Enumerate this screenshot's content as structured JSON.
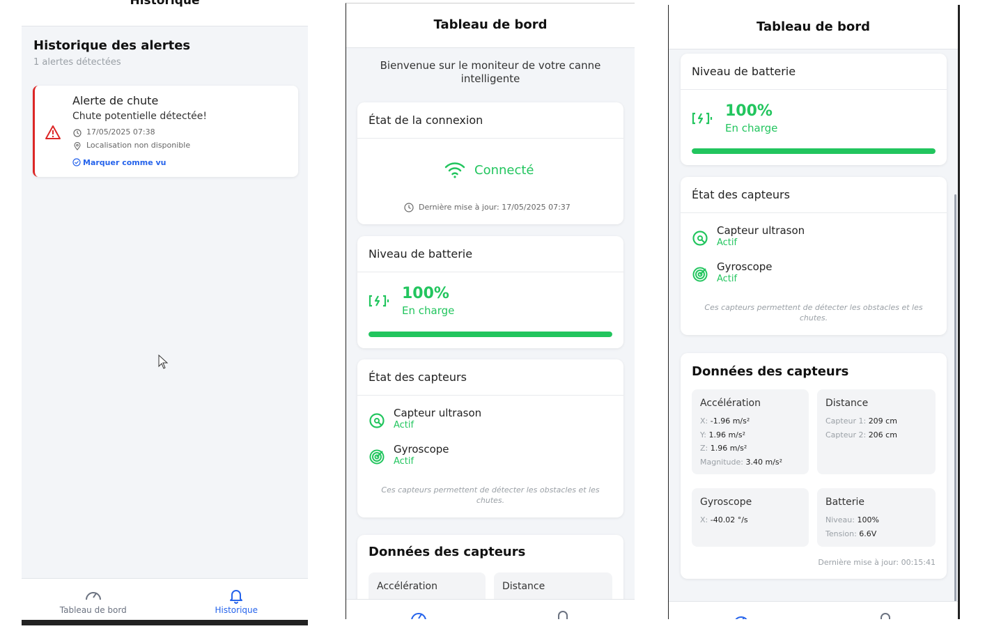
{
  "history_screen": {
    "header_title": "Historique",
    "section_title": "Historique des alertes",
    "count_text": "1 alertes détectées",
    "alert": {
      "title": "Alerte de chute",
      "message": "Chute potentielle détectée!",
      "time": "17/05/2025 07:38",
      "location": "Localisation non disponible",
      "action": "Marquer comme vu"
    },
    "tabs": [
      {
        "label": "Tableau de bord",
        "icon": "gauge-icon"
      },
      {
        "label": "Historique",
        "icon": "bell-icon"
      }
    ]
  },
  "dashboard_screen": {
    "header_title": "Tableau de bord",
    "welcome": "Bienvenue sur le moniteur de votre canne intelligente",
    "connection": {
      "title": "État de la connexion",
      "status": "Connecté",
      "updated": "Dernière mise à jour: 17/05/2025 07:37"
    },
    "battery": {
      "title": "Niveau de batterie",
      "percent": "100%",
      "state": "En charge",
      "level": 1.0
    },
    "sensors": {
      "title": "État des capteurs",
      "items": [
        {
          "name": "Capteur ultrason",
          "state": "Actif",
          "icon": "ultrasound-icon"
        },
        {
          "name": "Gyroscope",
          "state": "Actif",
          "icon": "radar-icon"
        }
      ],
      "note": "Ces capteurs permettent de détecter les obstacles et les chutes."
    },
    "data": {
      "title": "Données des capteurs",
      "tiles": [
        "Accélération",
        "Distance"
      ]
    }
  },
  "dashboard_scrolled": {
    "header_title": "Tableau de bord",
    "battery": {
      "title": "Niveau de batterie",
      "percent": "100%",
      "state": "En charge",
      "level": 1.0
    },
    "sensors": {
      "title": "État des capteurs",
      "items": [
        {
          "name": "Capteur ultrason",
          "state": "Actif"
        },
        {
          "name": "Gyroscope",
          "state": "Actif"
        }
      ],
      "note": "Ces capteurs permettent de détecter les obstacles et les chutes."
    },
    "data": {
      "title": "Données des capteurs",
      "acceleration": {
        "title": "Accélération",
        "x_label": "X:",
        "x_value": "-1.96 m/s²",
        "y_label": "Y:",
        "y_value": "1.96 m/s²",
        "z_label": "Z:",
        "z_value": "1.96 m/s²",
        "mag_label": "Magnitude:",
        "mag_value": "3.40 m/s²"
      },
      "distance": {
        "title": "Distance",
        "s1_label": "Capteur 1:",
        "s1_value": "209 cm",
        "s2_label": "Capteur 2:",
        "s2_value": "206 cm"
      },
      "gyroscope": {
        "title": "Gyroscope",
        "x_label": "X:",
        "x_value": "-40.02 °/s"
      },
      "battery": {
        "title": "Batterie",
        "level_label": "Niveau:",
        "level_value": "100%",
        "voltage_label": "Tension:",
        "voltage_value": "6.6V"
      },
      "updated": "Dernière mise à jour: 00:15:41"
    }
  },
  "colors": {
    "accent_green": "#22c55e",
    "alert_red": "#dc2626",
    "link_blue": "#2563eb"
  }
}
